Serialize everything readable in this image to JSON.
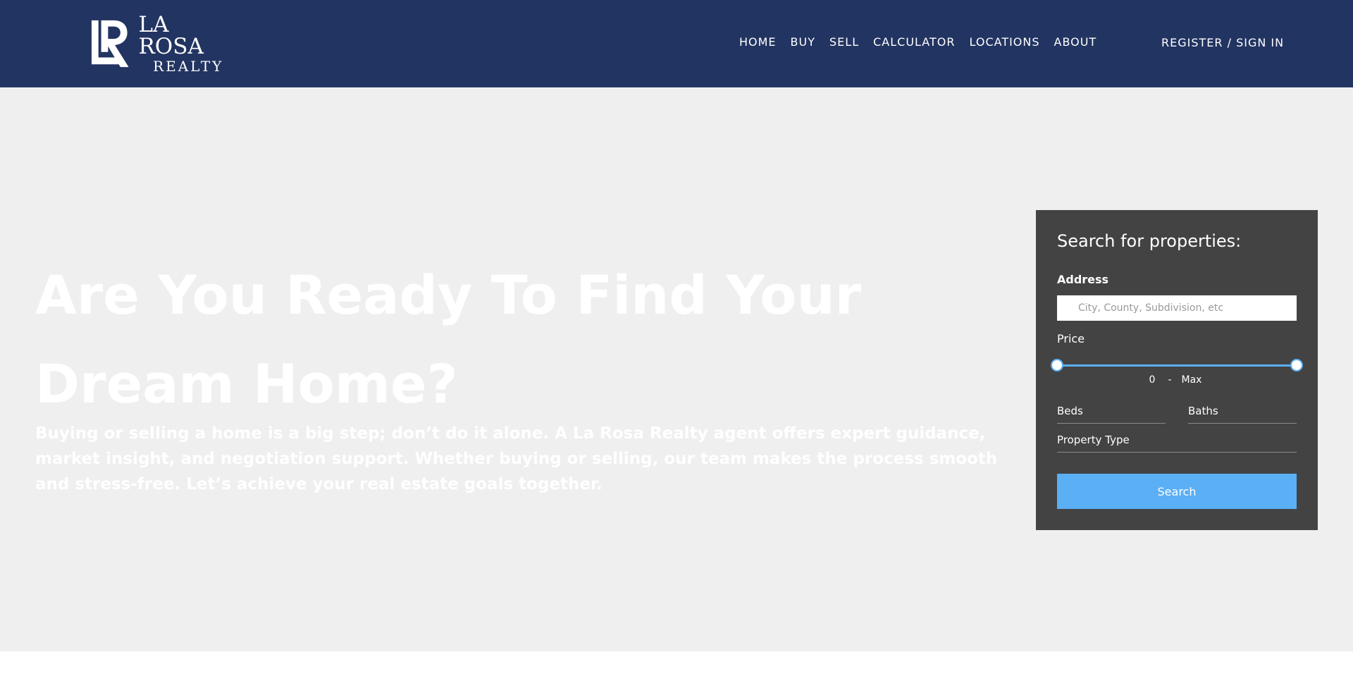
{
  "header": {
    "logo": {
      "brand_top": "LA ROSA",
      "brand_bottom": "REALTY"
    },
    "nav": [
      {
        "label": "HOME"
      },
      {
        "label": "BUY"
      },
      {
        "label": "SELL"
      },
      {
        "label": "CALCULATOR"
      },
      {
        "label": "LOCATIONS"
      },
      {
        "label": "ABOUT"
      }
    ],
    "register_label": "REGISTER / SIGN IN"
  },
  "hero": {
    "title_line1": "Are You Ready To Find Your",
    "title_line2": "Dream Home?",
    "description": "Buying or selling a home is a big step; don’t do it alone. A La Rosa Realty agent offers expert guidance, market insight, and negotiation support. Whether buying or selling, our team makes the process smooth and stress-free. Let’s achieve your real estate goals together."
  },
  "search_panel": {
    "title": "Search for properties:",
    "address_label": "Address",
    "address_value": "",
    "address_placeholder": "City, County, Subdivision, etc",
    "price_label": "Price",
    "price_min": "0",
    "price_separator": "-",
    "price_max": "Max",
    "price_slider": {
      "min_fraction": 0,
      "max_fraction": 1
    },
    "beds_label": "Beds",
    "baths_label": "Baths",
    "property_type_label": "Property Type",
    "search_button_label": "Search"
  },
  "colors": {
    "header_bg": "#223461",
    "hero_bg": "#efefef",
    "panel_bg": "#434343",
    "accent": "#5aaff5"
  }
}
